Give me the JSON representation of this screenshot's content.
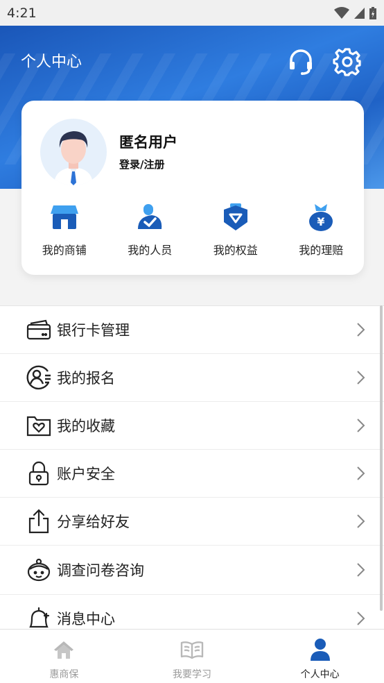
{
  "status_bar": {
    "time": "4:21"
  },
  "header": {
    "title": "个人中心"
  },
  "profile": {
    "name": "匿名用户",
    "login": "登录/注册"
  },
  "quick_links": [
    {
      "label": "我的商铺",
      "icon": "shop-icon"
    },
    {
      "label": "我的人员",
      "icon": "staff-icon"
    },
    {
      "label": "我的权益",
      "icon": "benefits-shield-icon"
    },
    {
      "label": "我的理赔",
      "icon": "claims-money-bag-icon"
    }
  ],
  "menu": [
    {
      "label": "银行卡管理",
      "icon": "bank-card-icon"
    },
    {
      "label": "我的报名",
      "icon": "registration-user-icon"
    },
    {
      "label": "我的收藏",
      "icon": "favorites-folder-icon"
    },
    {
      "label": "账户安全",
      "icon": "lock-icon"
    },
    {
      "label": "分享给好友",
      "icon": "share-icon"
    },
    {
      "label": "调查问卷咨询",
      "icon": "survey-face-icon"
    },
    {
      "label": "消息中心",
      "icon": "bell-icon"
    }
  ],
  "bottom_nav": [
    {
      "label": "惠商保",
      "icon": "home-icon",
      "active": false
    },
    {
      "label": "我要学习",
      "icon": "book-icon",
      "active": false
    },
    {
      "label": "个人中心",
      "icon": "person-icon",
      "active": true
    }
  ],
  "colors": {
    "brand_blue": "#1f62c6",
    "accent_blue": "#2a7ee0",
    "inactive_gray": "#b8b8b8"
  }
}
